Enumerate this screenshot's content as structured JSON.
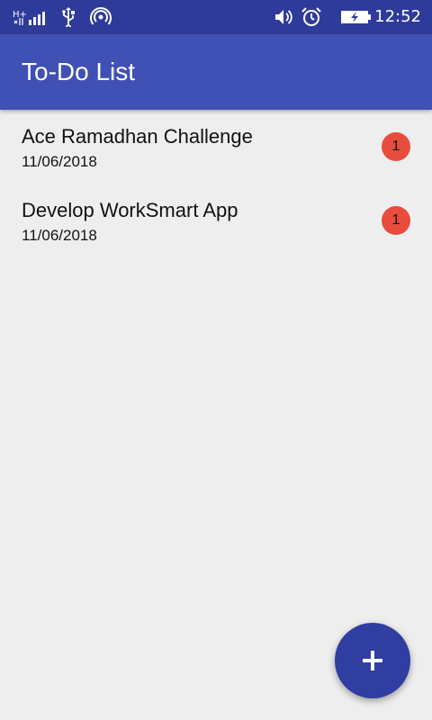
{
  "status_bar": {
    "network_label": "H+",
    "time": "12:52",
    "icons": [
      "network-signal-icon",
      "usb-icon",
      "hotspot-icon",
      "volume-icon",
      "alarm-icon",
      "battery-charging-icon"
    ]
  },
  "app_bar": {
    "title": "To-Do List"
  },
  "tasks": [
    {
      "title": "Ace Ramadhan Challenge",
      "date": "11/06/2018",
      "badge": "1"
    },
    {
      "title": "Develop WorkSmart App",
      "date": "11/06/2018",
      "badge": "1"
    }
  ],
  "fab": {
    "icon": "add-icon"
  },
  "colors": {
    "status_bar": "#2f3b9a",
    "app_bar": "#3f51b5",
    "background": "#eeeeee",
    "badge": "#e74c3c",
    "fab": "#2f3ea0"
  }
}
